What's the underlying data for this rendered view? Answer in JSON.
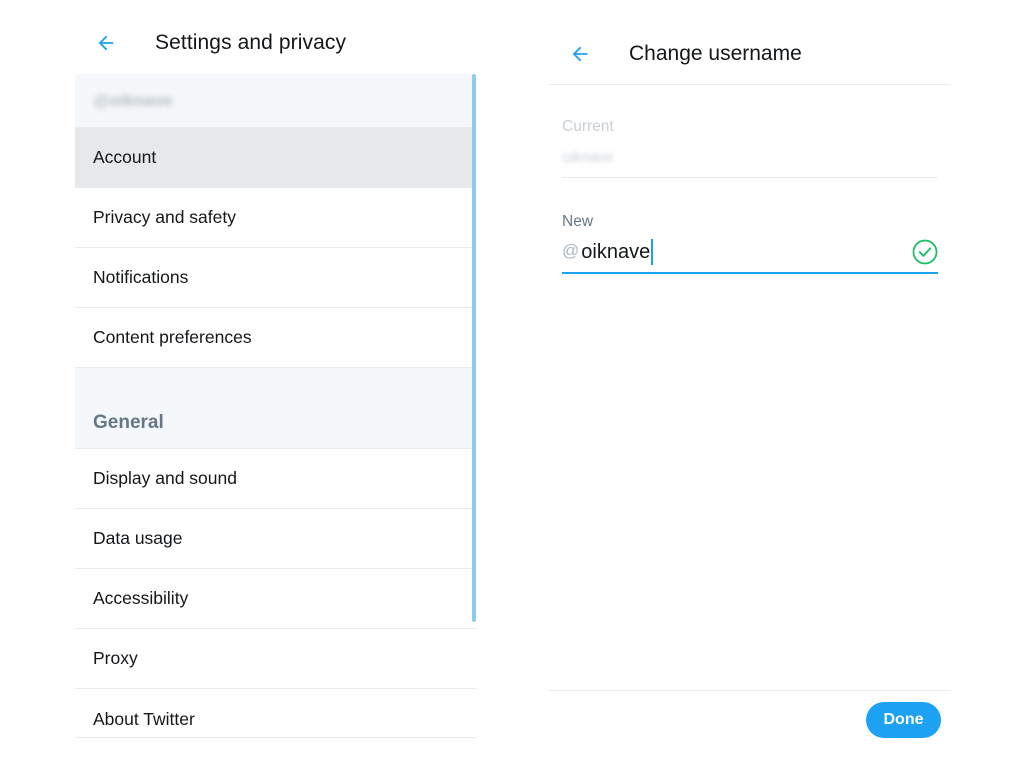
{
  "left": {
    "title": "Settings and privacy",
    "back_icon": "arrow-left-icon",
    "user_handle": "@oiknave",
    "account_items": [
      {
        "label": "Account",
        "selected": true
      },
      {
        "label": "Privacy and safety",
        "selected": false
      },
      {
        "label": "Notifications",
        "selected": false
      },
      {
        "label": "Content preferences",
        "selected": false
      }
    ],
    "general_title": "General",
    "general_items": [
      {
        "label": "Display and sound"
      },
      {
        "label": "Data usage"
      },
      {
        "label": "Accessibility"
      },
      {
        "label": "Proxy"
      },
      {
        "label": "About Twitter"
      }
    ]
  },
  "right": {
    "title": "Change username",
    "back_icon": "arrow-left-icon",
    "current_label": "Current",
    "current_value": "oiknave",
    "new_label": "New",
    "at_prefix": "@",
    "new_value": "oiknave",
    "valid_icon": "check-circle-icon",
    "done_label": "Done"
  },
  "colors": {
    "accent": "#1da1f2",
    "success": "#17bf63",
    "selected_row": "#e6e8ea",
    "section_bg": "#f5f8fa",
    "secondary_text": "#657786"
  }
}
